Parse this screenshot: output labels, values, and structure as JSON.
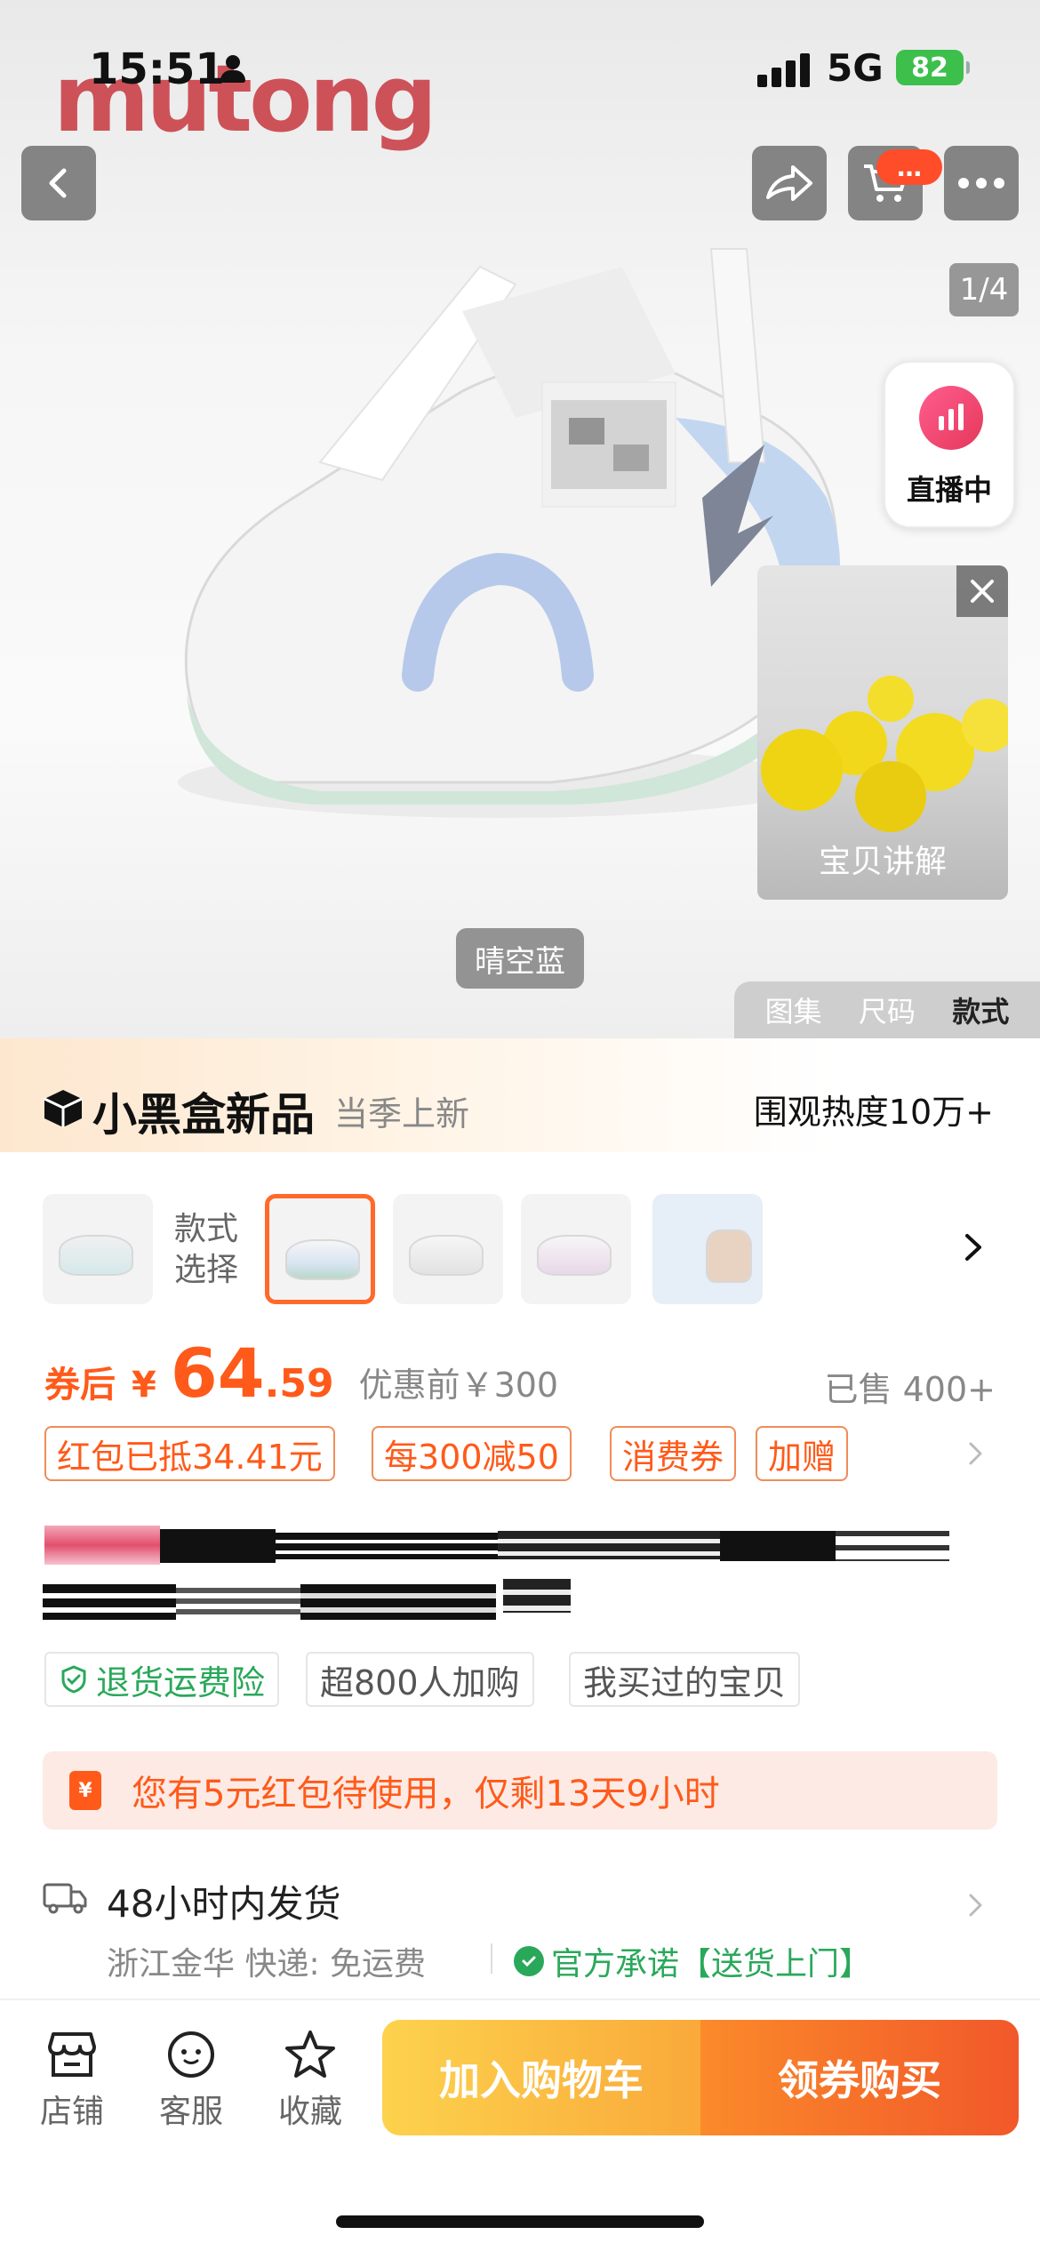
{
  "status_bar": {
    "time": "15:51",
    "network": "5G",
    "battery": "82"
  },
  "hero": {
    "brand_logo": "mutong",
    "image_counter": "1/4",
    "cart_badge": "…",
    "live": {
      "label": "直播中"
    },
    "explain": {
      "label": "宝贝讲解"
    },
    "color_tag": "晴空蓝",
    "gallery_tabs": [
      "图集",
      "尺码",
      "款式"
    ],
    "active_gallery_tab": "款式"
  },
  "banner": {
    "title": "小黑盒新品",
    "subtitle": "当季上新",
    "heat": "围观热度10万+"
  },
  "style_select": {
    "label": "款式选择"
  },
  "price": {
    "prefix": "券后",
    "currency": "¥",
    "integer": "64",
    "decimal": ".59",
    "original": "优惠前￥300",
    "sold": "已售 400+"
  },
  "promos": [
    "红包已抵34.41元",
    "每300减50",
    "消费券",
    "加赠"
  ],
  "tags": [
    "退货运费险",
    "超800人加购",
    "我买过的宝贝"
  ],
  "coupon_notice": {
    "icon_text": "¥",
    "text": "您有5元红包待使用，仅剩13天9小时"
  },
  "shipping": {
    "title": "48小时内发货",
    "origin": "浙江金华  快递: 免运费",
    "promise": "官方承诺【送货上门】"
  },
  "bottom_bar": {
    "shop": "店铺",
    "service": "客服",
    "favorite": "收藏",
    "add_to_cart": "加入购物车",
    "buy": "领券购买"
  },
  "colors": {
    "accent": "#ff5a1a",
    "green": "#2aa85a",
    "cta_yellow": "#f9a93a",
    "cta_orange": "#f1582a"
  }
}
